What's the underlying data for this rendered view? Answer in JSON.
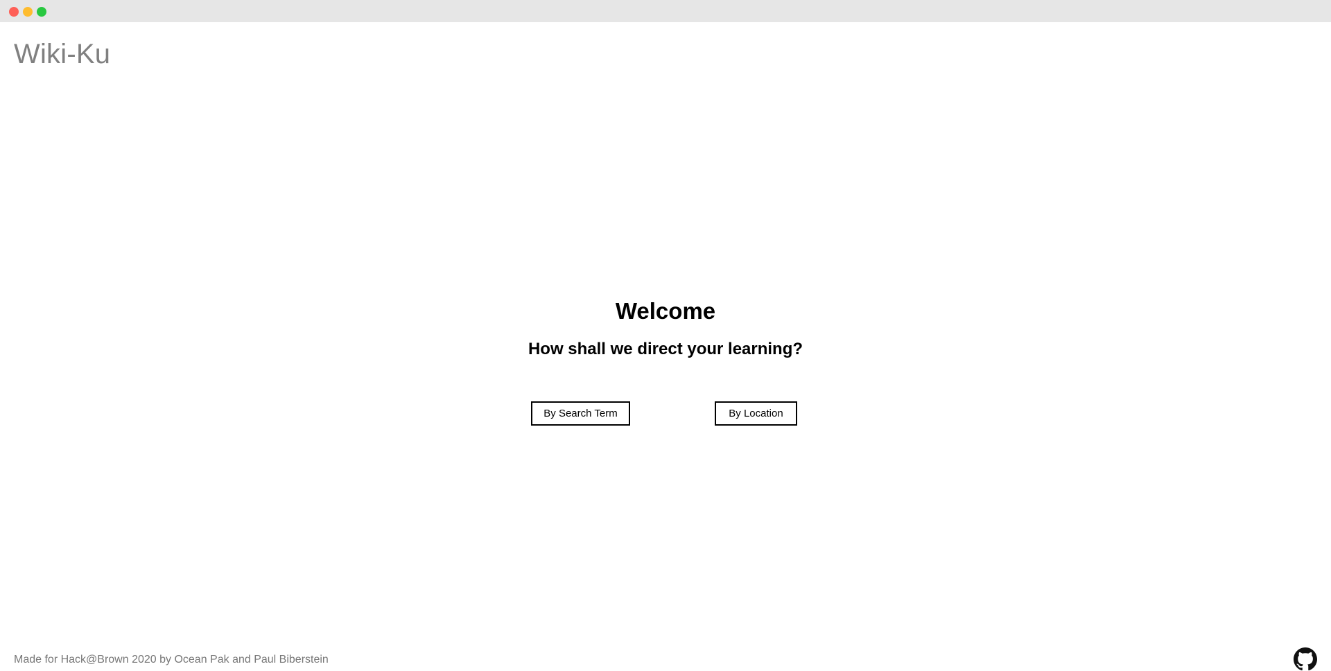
{
  "header": {
    "brand": "Wiki-Ku"
  },
  "main": {
    "title": "Welcome",
    "question": "How shall we direct your learning?",
    "buttons": {
      "search_label": "By Search Term",
      "location_label": "By Location"
    }
  },
  "footer": {
    "credit": "Made for Hack@Brown 2020 by Ocean Pak and Paul Biberstein",
    "icon": "github-icon"
  },
  "colors": {
    "brand_text": "#808080",
    "footer_text": "#777777",
    "titlebar": "#e6e6e6",
    "close": "#fe5f57",
    "minimize": "#febc2e",
    "maximize": "#28c840"
  }
}
